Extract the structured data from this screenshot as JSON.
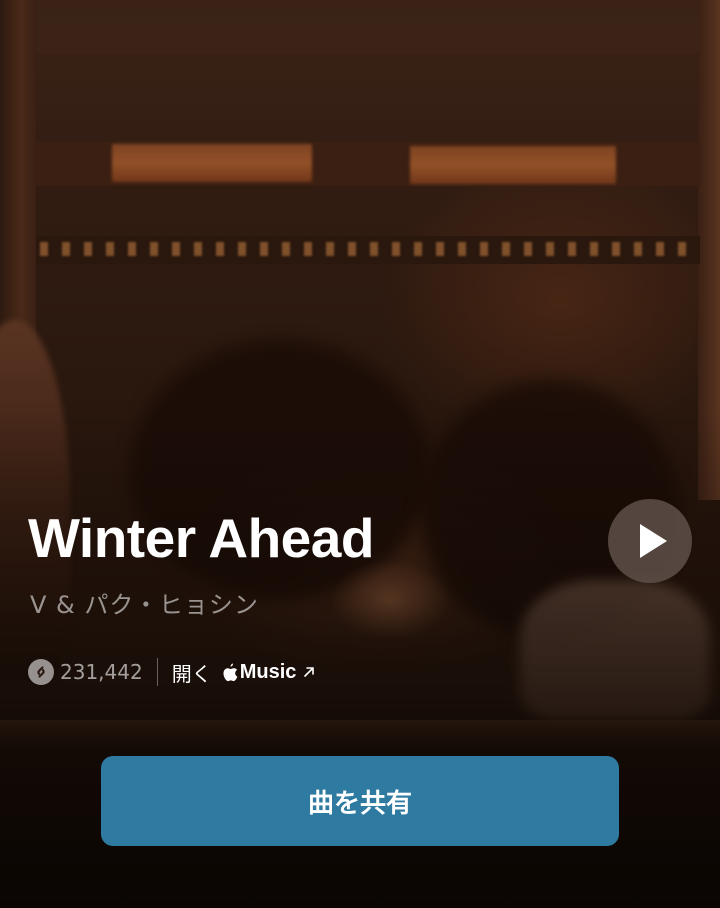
{
  "song": {
    "title": "Winter Ahead",
    "artist": "V & パク・ヒョシン"
  },
  "stats": {
    "shazam_count": "231,442"
  },
  "open_link": {
    "label": "開く",
    "service": "Music"
  },
  "share_button": {
    "label": "曲を共有"
  },
  "icons": {
    "play": "play-icon",
    "shazam": "shazam-icon",
    "apple": "apple-logo-icon",
    "external": "arrow-up-right-icon"
  },
  "colors": {
    "share_button_bg": "#2f7aa1",
    "title_text": "#ffffff"
  }
}
